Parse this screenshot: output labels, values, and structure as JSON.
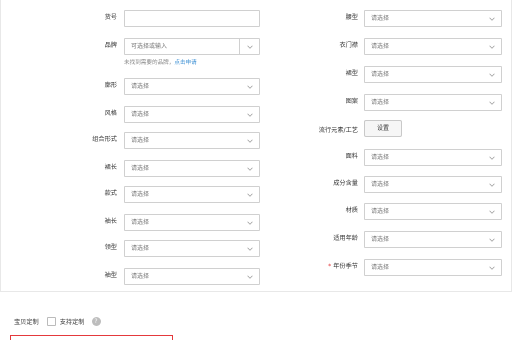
{
  "left": {
    "huohao": {
      "label": "货号",
      "value": ""
    },
    "pinpai": {
      "label": "品牌",
      "placeholder": "可选择或输入",
      "hint_prefix": "未找到需要的品牌，",
      "hint_link": "点击申请"
    },
    "rows": [
      {
        "label": "廓形",
        "value": "请选择"
      },
      {
        "label": "风格",
        "value": "请选择"
      },
      {
        "label": "组合形式",
        "value": "请选择"
      },
      {
        "label": "裙长",
        "value": "请选择"
      },
      {
        "label": "款式",
        "value": "请选择"
      },
      {
        "label": "袖长",
        "value": "请选择"
      },
      {
        "label": "领型",
        "value": "请选择"
      },
      {
        "label": "袖型",
        "value": "请选择"
      }
    ]
  },
  "right": {
    "rows": [
      {
        "label": "腰型",
        "value": "请选择"
      },
      {
        "label": "衣门襟",
        "value": "请选择"
      },
      {
        "label": "裙型",
        "value": "请选择"
      },
      {
        "label": "图案",
        "value": "请选择"
      }
    ],
    "liuxing": {
      "label": "流行元素/工艺",
      "button": "设置"
    },
    "rows2": [
      {
        "label": "面料",
        "value": "请选择"
      },
      {
        "label": "成分含量",
        "value": "请选择"
      },
      {
        "label": "材质",
        "value": "请选择"
      },
      {
        "label": "适用年龄",
        "value": "请选择"
      },
      {
        "label": "年份季节",
        "value": "请选择",
        "required": "*"
      }
    ]
  },
  "custom": {
    "label": "宝贝定制",
    "checkbox_label": "支持定制",
    "help": "?"
  },
  "colors": {
    "required": "#e4393c",
    "link": "#3b8fd4",
    "border": "#d0d0d0"
  },
  "icons": {
    "select_caret": "chevron-down-icon",
    "help": "question-circle-icon"
  }
}
